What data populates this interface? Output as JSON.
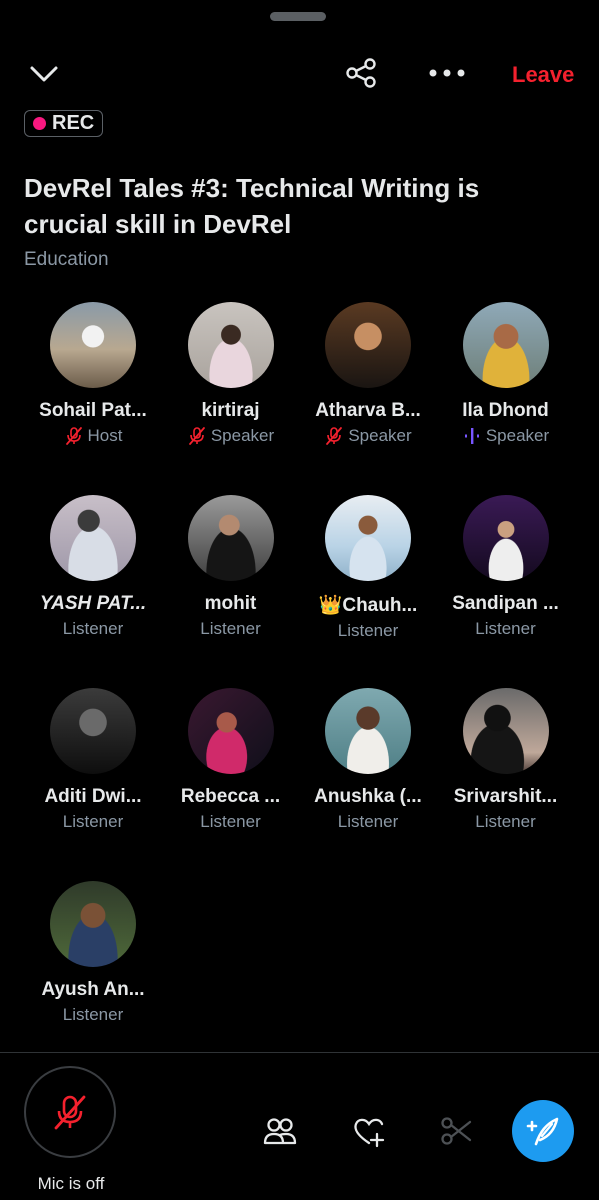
{
  "header": {
    "leave_label": "Leave",
    "rec_label": "REC"
  },
  "space": {
    "title": "DevRel Tales #3: Technical Writing is crucial skill in DevRel",
    "category": "Education"
  },
  "participants": [
    {
      "name": "Sohail Pat...",
      "role": "Host",
      "role_icon": "mic-off-icon"
    },
    {
      "name": "kirtiraj",
      "role": "Speaker",
      "role_icon": "mic-off-icon"
    },
    {
      "name": "Atharva B...",
      "role": "Speaker",
      "role_icon": "mic-off-icon"
    },
    {
      "name": "Ila Dhond",
      "role": "Speaker",
      "role_icon": "speaking-bars-icon"
    },
    {
      "name": "YASH PAT...",
      "role": "Listener",
      "role_icon": ""
    },
    {
      "name": "mohit",
      "role": "Listener",
      "role_icon": ""
    },
    {
      "name": "👑Chauh...",
      "role": "Listener",
      "role_icon": ""
    },
    {
      "name": "Sandipan ...",
      "role": "Listener",
      "role_icon": ""
    },
    {
      "name": "Aditi Dwi...",
      "role": "Listener",
      "role_icon": ""
    },
    {
      "name": "Rebecca ...",
      "role": "Listener",
      "role_icon": ""
    },
    {
      "name": "Anushka (...",
      "role": "Listener",
      "role_icon": ""
    },
    {
      "name": "Srivarshit...",
      "role": "Listener",
      "role_icon": ""
    },
    {
      "name": "Ayush An...",
      "role": "Listener",
      "role_icon": ""
    }
  ],
  "bottom_bar": {
    "mic_label": "Mic is off",
    "icons": [
      "people-icon",
      "heart-plus-icon",
      "scissors-icon",
      "compose-icon"
    ]
  },
  "colors": {
    "accent": "#1d9bf0",
    "leave": "#f4212e",
    "rec_dot": "#f91880",
    "mic_off": "#f4212e",
    "speaking": "#7856ff"
  }
}
